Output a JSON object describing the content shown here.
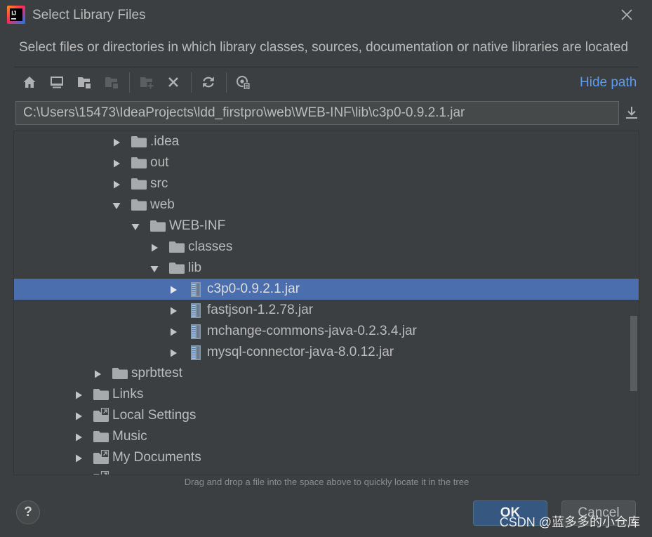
{
  "window": {
    "title": "Select Library Files",
    "app_icon": "intellij-idea-logo-icon",
    "app_icon_text": "IJ",
    "close_icon": "close-icon"
  },
  "description": "Select files or directories in which library classes, sources, documentation or native libraries are located",
  "toolbar": {
    "buttons": [
      {
        "icon": "home-icon",
        "enabled": true
      },
      {
        "icon": "desktop-icon",
        "enabled": true
      },
      {
        "icon": "project-folder-icon",
        "enabled": true
      },
      {
        "icon": "module-folder-icon",
        "enabled": false
      },
      {
        "icon": "new-folder-icon",
        "enabled": false
      },
      {
        "icon": "delete-icon",
        "enabled": true
      },
      {
        "icon": "refresh-icon",
        "enabled": true
      },
      {
        "icon": "show-hidden-files-icon",
        "enabled": true
      }
    ],
    "hide_path_label": "Hide path"
  },
  "path_field": {
    "value": "C:\\Users\\15473\\IdeaProjects\\ldd_firstpro\\web\\WEB-INF\\lib\\c3p0-0.9.2.1.jar",
    "action_icon": "download-icon"
  },
  "tree": {
    "rows": [
      {
        "label": ".idea",
        "depth": 2,
        "expanded": false,
        "icon": "folder-icon"
      },
      {
        "label": "out",
        "depth": 2,
        "expanded": false,
        "icon": "folder-icon"
      },
      {
        "label": "src",
        "depth": 2,
        "expanded": false,
        "icon": "folder-icon"
      },
      {
        "label": "web",
        "depth": 2,
        "expanded": true,
        "icon": "folder-icon"
      },
      {
        "label": "WEB-INF",
        "depth": 3,
        "expanded": true,
        "icon": "folder-icon"
      },
      {
        "label": "classes",
        "depth": 4,
        "expanded": false,
        "icon": "folder-icon"
      },
      {
        "label": "lib",
        "depth": 4,
        "expanded": true,
        "icon": "folder-icon"
      },
      {
        "label": "c3p0-0.9.2.1.jar",
        "depth": 5,
        "expanded": false,
        "icon": "jar-icon",
        "selected": true
      },
      {
        "label": "fastjson-1.2.78.jar",
        "depth": 5,
        "expanded": false,
        "icon": "jar-icon"
      },
      {
        "label": "mchange-commons-java-0.2.3.4.jar",
        "depth": 5,
        "expanded": false,
        "icon": "jar-icon"
      },
      {
        "label": "mysql-connector-java-8.0.12.jar",
        "depth": 5,
        "expanded": false,
        "icon": "jar-icon"
      },
      {
        "label": "sprbttest",
        "depth": 1,
        "expanded": false,
        "icon": "folder-icon"
      },
      {
        "label": "Links",
        "depth": 0,
        "expanded": false,
        "icon": "folder-icon"
      },
      {
        "label": "Local Settings",
        "depth": 0,
        "expanded": false,
        "icon": "folder-link-icon"
      },
      {
        "label": "Music",
        "depth": 0,
        "expanded": false,
        "icon": "folder-icon"
      },
      {
        "label": "My Documents",
        "depth": 0,
        "expanded": false,
        "icon": "folder-link-icon"
      },
      {
        "label": "",
        "depth": 0,
        "expanded": false,
        "icon": "folder-link-icon"
      }
    ]
  },
  "hint": "Drag and drop a file into the space above to quickly locate it in the tree",
  "footer": {
    "help_label": "?",
    "ok_label": "OK",
    "cancel_label": "Cancel"
  },
  "watermark": "CSDN @蓝多多的小仓库",
  "colors": {
    "background": "#3C3F41",
    "text": "#BBBBBB",
    "selection": "#4B6EAF",
    "link": "#589DF6",
    "default_button": "#365880",
    "button": "#4C5052"
  }
}
